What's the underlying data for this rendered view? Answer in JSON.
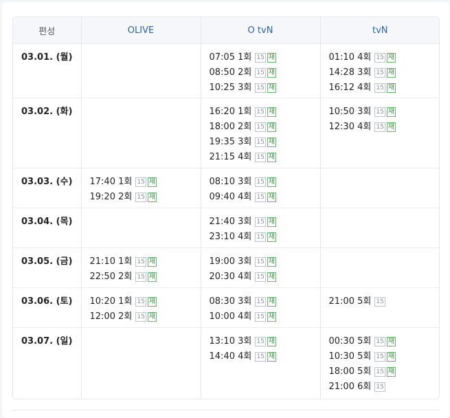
{
  "header": {
    "col_label": "편성",
    "channels": [
      "OLIVE",
      "O tvN",
      "tvN"
    ]
  },
  "rows": [
    {
      "date": "03.01. (월)",
      "cells": [
        [],
        [
          {
            "time": "07:05",
            "ep": "1회",
            "rating": "15",
            "rerun": "재"
          },
          {
            "time": "08:50",
            "ep": "2회",
            "rating": "15",
            "rerun": "재"
          },
          {
            "time": "10:25",
            "ep": "3회",
            "rating": "15",
            "rerun": "재"
          }
        ],
        [
          {
            "time": "01:10",
            "ep": "4회",
            "rating": "15",
            "rerun": "재"
          },
          {
            "time": "14:28",
            "ep": "3회",
            "rating": "15",
            "rerun": "재"
          },
          {
            "time": "16:12",
            "ep": "4회",
            "rating": "15",
            "rerun": "재"
          }
        ]
      ]
    },
    {
      "date": "03.02. (화)",
      "cells": [
        [],
        [
          {
            "time": "16:20",
            "ep": "1회",
            "rating": "15",
            "rerun": "재"
          },
          {
            "time": "18:00",
            "ep": "2회",
            "rating": "15",
            "rerun": "재"
          },
          {
            "time": "19:35",
            "ep": "3회",
            "rating": "15",
            "rerun": "재"
          },
          {
            "time": "21:15",
            "ep": "4회",
            "rating": "15",
            "rerun": "재"
          }
        ],
        [
          {
            "time": "10:50",
            "ep": "3회",
            "rating": "15",
            "rerun": "재"
          },
          {
            "time": "12:30",
            "ep": "4회",
            "rating": "15",
            "rerun": "재"
          }
        ]
      ]
    },
    {
      "date": "03.03. (수)",
      "cells": [
        [
          {
            "time": "17:40",
            "ep": "1회",
            "rating": "15",
            "rerun": "재"
          },
          {
            "time": "19:20",
            "ep": "2회",
            "rating": "15",
            "rerun": "재"
          }
        ],
        [
          {
            "time": "08:10",
            "ep": "3회",
            "rating": "15",
            "rerun": "재"
          },
          {
            "time": "09:40",
            "ep": "4회",
            "rating": "15",
            "rerun": "재"
          }
        ],
        []
      ]
    },
    {
      "date": "03.04. (목)",
      "cells": [
        [],
        [
          {
            "time": "21:40",
            "ep": "3회",
            "rating": "15",
            "rerun": "재"
          },
          {
            "time": "23:10",
            "ep": "4회",
            "rating": "15",
            "rerun": "재"
          }
        ],
        []
      ]
    },
    {
      "date": "03.05. (금)",
      "cells": [
        [
          {
            "time": "21:10",
            "ep": "1회",
            "rating": "15",
            "rerun": "재"
          },
          {
            "time": "22:50",
            "ep": "2회",
            "rating": "15",
            "rerun": "재"
          }
        ],
        [
          {
            "time": "19:00",
            "ep": "3회",
            "rating": "15",
            "rerun": "재"
          },
          {
            "time": "20:30",
            "ep": "4회",
            "rating": "15",
            "rerun": "재"
          }
        ],
        []
      ]
    },
    {
      "date": "03.06. (토)",
      "cells": [
        [
          {
            "time": "10:20",
            "ep": "1회",
            "rating": "15",
            "rerun": "재"
          },
          {
            "time": "12:00",
            "ep": "2회",
            "rating": "15",
            "rerun": "재"
          }
        ],
        [
          {
            "time": "08:30",
            "ep": "3회",
            "rating": "15",
            "rerun": "재"
          },
          {
            "time": "10:00",
            "ep": "4회",
            "rating": "15",
            "rerun": "재"
          }
        ],
        [
          {
            "time": "21:00",
            "ep": "5회",
            "rating": "15",
            "rerun": ""
          }
        ]
      ]
    },
    {
      "date": "03.07. (일)",
      "cells": [
        [],
        [
          {
            "time": "13:10",
            "ep": "3회",
            "rating": "15",
            "rerun": "재"
          },
          {
            "time": "14:40",
            "ep": "4회",
            "rating": "15",
            "rerun": "재"
          }
        ],
        [
          {
            "time": "00:30",
            "ep": "5회",
            "rating": "15",
            "rerun": "재"
          },
          {
            "time": "10:30",
            "ep": "5회",
            "rating": "15",
            "rerun": "재"
          },
          {
            "time": "18:00",
            "ep": "5회",
            "rating": "15",
            "rerun": "재"
          },
          {
            "time": "21:00",
            "ep": "6회",
            "rating": "15",
            "rerun": ""
          }
        ]
      ]
    }
  ]
}
